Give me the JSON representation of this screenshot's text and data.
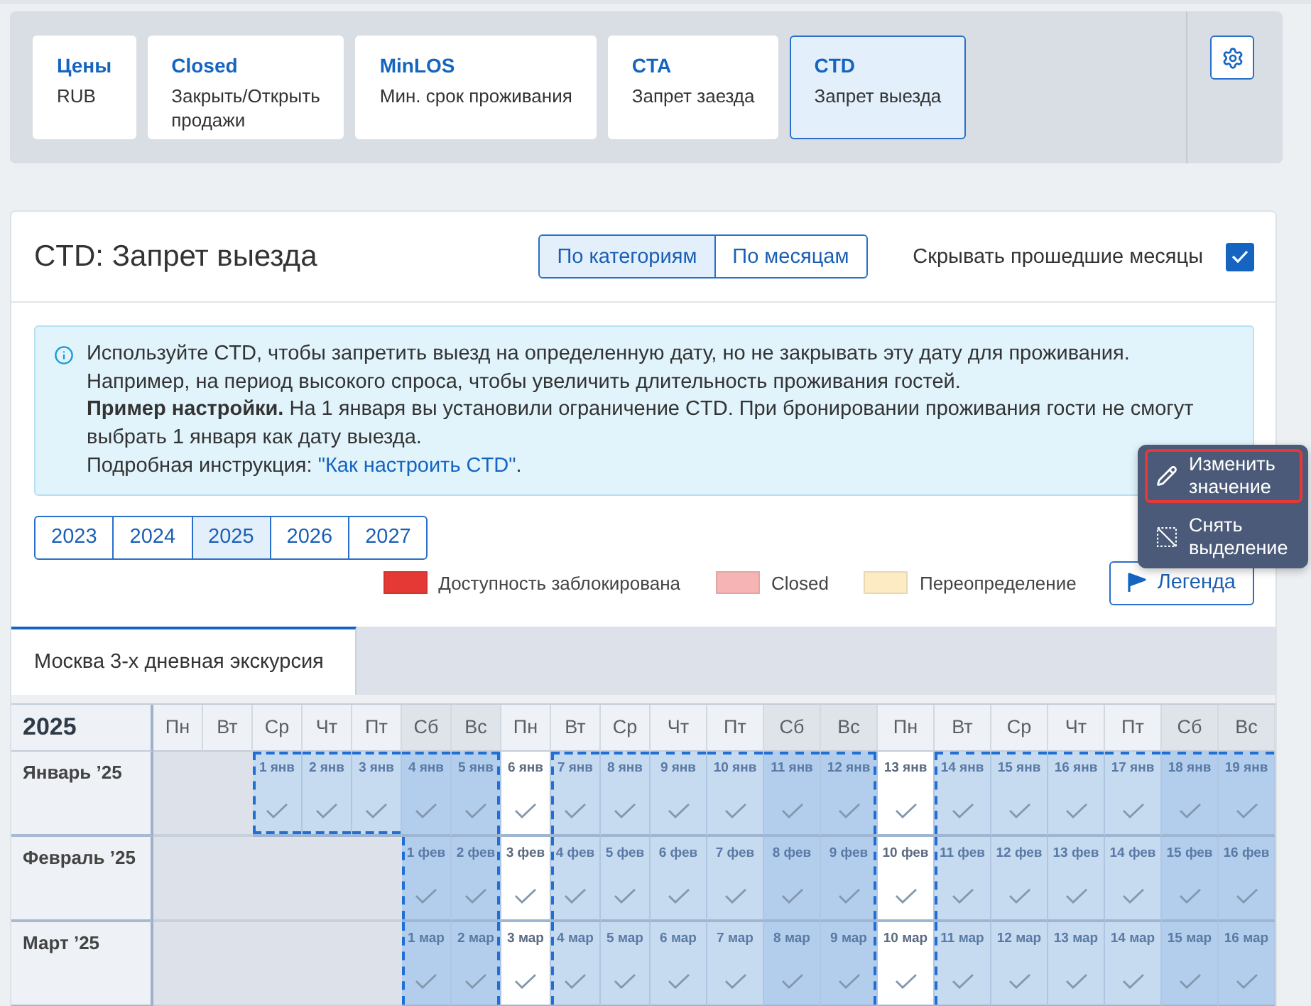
{
  "restriction_tabs": [
    {
      "title": "Цены",
      "subtitle": "RUB",
      "selected": false
    },
    {
      "title": "Closed",
      "subtitle": "Закрыть/Открыть\nпродажи",
      "selected": false
    },
    {
      "title": "MinLOS",
      "subtitle": "Мин. срок проживания",
      "selected": false
    },
    {
      "title": "CTA",
      "subtitle": "Запрет заезда",
      "selected": false
    },
    {
      "title": "CTD",
      "subtitle": "Запрет выезда",
      "selected": true
    }
  ],
  "page": {
    "title": "CTD: Запрет выезда"
  },
  "view_switch": [
    {
      "label": "По категориям",
      "selected": true
    },
    {
      "label": "По месяцам",
      "selected": false
    }
  ],
  "hide_past_months": {
    "label": "Скрывать прошедшие месяцы",
    "checked": true
  },
  "info": {
    "lines": [
      "Используйте CTD, чтобы запретить выезд на определенную дату, но не закрывать эту дату для проживания.",
      "Например, на период высокого спроса, чтобы увеличить длительность проживания гостей.",
      "**Пример настройки.** На 1 января вы установили ограничение CTD. При бронировании проживания гости не смогут выбрать 1 января как дату выезда."
    ],
    "instruction": {
      "text": "Подробная инструкция: ",
      "link": "\"Как настроить CTD\"",
      "suffix": "."
    }
  },
  "years": [
    {
      "label": "2023",
      "selected": false
    },
    {
      "label": "2024",
      "selected": false
    },
    {
      "label": "2025",
      "selected": true
    },
    {
      "label": "2026",
      "selected": false
    },
    {
      "label": "2027",
      "selected": false
    }
  ],
  "legend": {
    "items": [
      {
        "label": "Доступность заблокирована",
        "color": "#e53935"
      },
      {
        "label": "Closed",
        "color": "#f6b4b4"
      },
      {
        "label": "Переопределение",
        "color": "#fdebc4"
      }
    ],
    "button": "Легенда"
  },
  "room_tabs": [
    {
      "label": "Москва 3-х дневная экскурсия",
      "selected": true
    }
  ],
  "calendar": {
    "year": "2025",
    "weekdays": [
      {
        "label": "Пн",
        "weekend": false
      },
      {
        "label": "Вт",
        "weekend": false
      },
      {
        "label": "Ср",
        "weekend": false
      },
      {
        "label": "Чт",
        "weekend": false
      },
      {
        "label": "Пт",
        "weekend": false
      },
      {
        "label": "Сб",
        "weekend": true
      },
      {
        "label": "Вс",
        "weekend": true
      },
      {
        "label": "Пн",
        "weekend": false
      },
      {
        "label": "Вт",
        "weekend": false
      },
      {
        "label": "Ср",
        "weekend": false
      },
      {
        "label": "Чт",
        "weekend": false
      },
      {
        "label": "Пт",
        "weekend": false
      },
      {
        "label": "Сб",
        "weekend": true
      },
      {
        "label": "Вс",
        "weekend": true
      },
      {
        "label": "Пн",
        "weekend": false
      },
      {
        "label": "Вт",
        "weekend": false
      },
      {
        "label": "Ср",
        "weekend": false
      },
      {
        "label": "Чт",
        "weekend": false
      },
      {
        "label": "Пт",
        "weekend": false
      },
      {
        "label": "Сб",
        "weekend": true
      },
      {
        "label": "Вс",
        "weekend": true
      }
    ],
    "months": [
      {
        "name": "Январь ’25",
        "days": [
          {
            "date": "1 янв",
            "selected": true,
            "checked": true
          },
          {
            "date": "2 янв",
            "selected": true,
            "checked": true
          },
          {
            "date": "3 янв",
            "selected": true,
            "checked": true
          },
          {
            "date": "4 янв",
            "selected": true,
            "checked": true
          },
          {
            "date": "5 янв",
            "selected": true,
            "checked": true
          },
          {
            "date": "6 янв",
            "selected": false,
            "checked": true
          },
          {
            "date": "7 янв",
            "selected": true,
            "checked": true
          },
          {
            "date": "8 янв",
            "selected": true,
            "checked": true
          },
          {
            "date": "9 янв",
            "selected": true,
            "checked": true
          },
          {
            "date": "10 янв",
            "selected": true,
            "checked": true
          },
          {
            "date": "11 янв",
            "selected": true,
            "checked": true
          },
          {
            "date": "12 янв",
            "selected": true,
            "checked": true
          },
          {
            "date": "13 янв",
            "selected": false,
            "checked": true
          },
          {
            "date": "14 янв",
            "selected": true,
            "checked": true
          },
          {
            "date": "15 янв",
            "selected": true,
            "checked": true
          },
          {
            "date": "16 янв",
            "selected": true,
            "checked": true
          },
          {
            "date": "17 янв",
            "selected": true,
            "checked": true
          },
          {
            "date": "18 янв",
            "selected": true,
            "checked": true
          },
          {
            "date": "19 янв",
            "selected": true,
            "checked": true
          }
        ]
      },
      {
        "name": "Февраль ’25",
        "days": [
          {
            "date": "1 фев",
            "selected": true,
            "checked": true
          },
          {
            "date": "2 фев",
            "selected": true,
            "checked": true
          },
          {
            "date": "3 фев",
            "selected": false,
            "checked": true
          },
          {
            "date": "4 фев",
            "selected": true,
            "checked": true
          },
          {
            "date": "5 фев",
            "selected": true,
            "checked": true
          },
          {
            "date": "6 фев",
            "selected": true,
            "checked": true
          },
          {
            "date": "7 фев",
            "selected": true,
            "checked": true
          },
          {
            "date": "8 фев",
            "selected": true,
            "checked": true
          },
          {
            "date": "9 фев",
            "selected": true,
            "checked": true
          },
          {
            "date": "10 фев",
            "selected": false,
            "checked": true
          },
          {
            "date": "11 фев",
            "selected": true,
            "checked": true
          },
          {
            "date": "12 фев",
            "selected": true,
            "checked": true
          },
          {
            "date": "13 фев",
            "selected": true,
            "checked": true
          },
          {
            "date": "14 фев",
            "selected": true,
            "checked": true
          },
          {
            "date": "15 фев",
            "selected": true,
            "checked": true
          },
          {
            "date": "16 фев",
            "selected": true,
            "checked": true
          }
        ]
      },
      {
        "name": "Март ’25",
        "days": [
          {
            "date": "1 мар",
            "selected": true,
            "checked": true
          },
          {
            "date": "2 мар",
            "selected": true,
            "checked": true
          },
          {
            "date": "3 мар",
            "selected": false,
            "checked": true
          },
          {
            "date": "4 мар",
            "selected": true,
            "checked": true
          },
          {
            "date": "5 мар",
            "selected": true,
            "checked": true
          },
          {
            "date": "6 мар",
            "selected": true,
            "checked": true
          },
          {
            "date": "7 мар",
            "selected": true,
            "checked": true
          },
          {
            "date": "8 мар",
            "selected": true,
            "checked": true
          },
          {
            "date": "9 мар",
            "selected": true,
            "checked": true
          },
          {
            "date": "10 мар",
            "selected": false,
            "checked": true
          },
          {
            "date": "11 мар",
            "selected": true,
            "checked": true
          },
          {
            "date": "12 мар",
            "selected": true,
            "checked": true
          },
          {
            "date": "13 мар",
            "selected": true,
            "checked": true
          },
          {
            "date": "14 мар",
            "selected": true,
            "checked": true
          },
          {
            "date": "15 мар",
            "selected": true,
            "checked": true
          },
          {
            "date": "16 мар",
            "selected": true,
            "checked": true
          }
        ]
      }
    ]
  },
  "context_menu": {
    "items": [
      {
        "kind": "edit",
        "label": "Изменить значение",
        "selected": true
      },
      {
        "kind": "deselect",
        "label": "Снять выделение",
        "selected": false
      }
    ]
  }
}
